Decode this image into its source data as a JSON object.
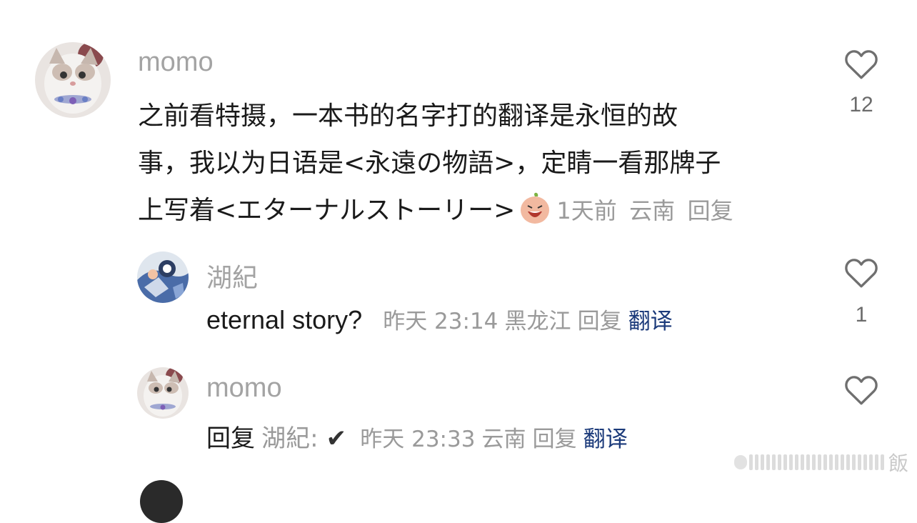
{
  "comments": [
    {
      "username": "momo",
      "text_lines": [
        "之前看特摄，一本书的名字打的翻译是永恒的故",
        "事，我以为日语是<永遠の物語>，定睛一看那牌子",
        "上写着<エターナルストーリー>"
      ],
      "time": "1天前",
      "location": "云南",
      "reply": "回复",
      "likes": "12",
      "emoji": "crying-face-emoji"
    },
    {
      "username": "湖紀",
      "text": "eternal story?",
      "time": "昨天 23:14",
      "location": "黑龙江",
      "reply": "回复",
      "translate": "翻译",
      "likes": "1"
    },
    {
      "username": "momo",
      "reply_prefix": "回复",
      "reply_to": "湖紀:",
      "text": "✔",
      "time": "昨天 23:33",
      "location": "云南",
      "reply": "回复",
      "translate": "翻译"
    }
  ],
  "watermark": {
    "text": "飯"
  },
  "icons": {
    "like": "heart-outline-icon",
    "avatar_cat": "cat-avatar",
    "avatar_anime": "anime-avatar"
  }
}
